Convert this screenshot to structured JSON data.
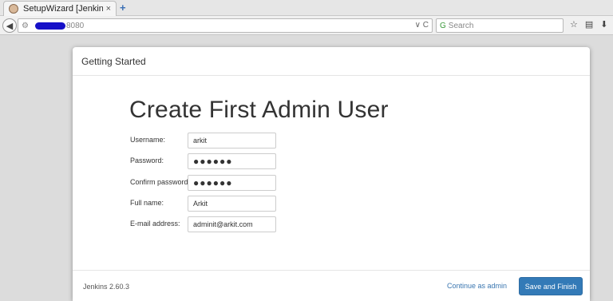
{
  "browser": {
    "tab_title": "SetupWizard [Jenkins]",
    "tab_close": "×",
    "new_tab": "+",
    "url_port": "8080",
    "search_placeholder": "Search",
    "url_dropdown": "∨",
    "url_reload": "C"
  },
  "modal": {
    "header_title": "Getting Started",
    "heading": "Create First Admin User",
    "fields": [
      {
        "label": "Username:",
        "value": "arkit"
      },
      {
        "label": "Password:",
        "value": "●●●●●●"
      },
      {
        "label": "Confirm password:",
        "value": "●●●●●●"
      },
      {
        "label": "Full name:",
        "value": "Arkit"
      },
      {
        "label": "E-mail address:",
        "value": "adminit@arkit.com"
      }
    ],
    "footer": {
      "version": "Jenkins 2.60.3",
      "continue_label": "Continue as admin",
      "finish_label": "Save and Finish"
    }
  },
  "colors": {
    "primary_button": "#337ab7",
    "link": "#3a76b0"
  }
}
